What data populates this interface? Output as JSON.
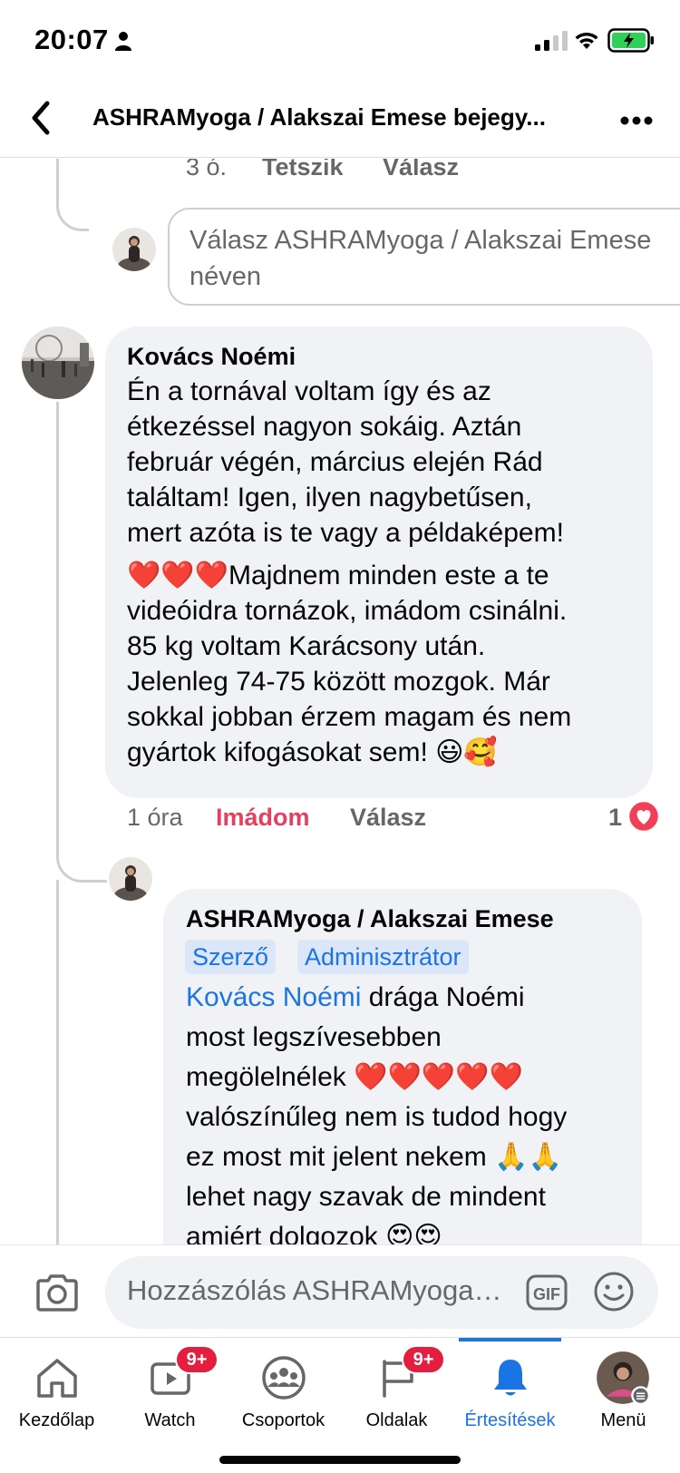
{
  "status_bar": {
    "time": "20:07",
    "icons": [
      "person-icon",
      "signal-icon",
      "wifi-icon",
      "battery-icon"
    ]
  },
  "header": {
    "title": "ASHRAMyoga   / Alakszai Emese bejegy...",
    "back_icon": "back-chevron-icon",
    "more_icon": "more-icon"
  },
  "previous_reply": {
    "time": "3 ó.",
    "like_label": "Tetszik",
    "reply_label": "Válasz"
  },
  "reply_box": {
    "placeholder": "Válasz ASHRAMyoga   / Alakszai Emese néven"
  },
  "comment": {
    "author": "Kovács Noémi",
    "lines": [
      "Én a tornával voltam így és az",
      "étkezéssel nagyon sokáig. Aztán",
      "február végén, március elején Rád",
      "találtam! Igen, ilyen nagybetűsen,",
      "mert azóta is te vagy a példaképem!"
    ],
    "lines2_first": "❤️❤️❤️Majdnem minden este a te",
    "lines2": [
      "videóidra tornázok, imádom csinálni.",
      "85 kg voltam Karácsony után.",
      "Jelenleg 74-75 között mozgok. Már",
      "sokkal jobban érzem magam és nem",
      "gyártok kifogásokat sem! 😃🥰"
    ],
    "time": "1 óra",
    "reaction_label": "Imádom",
    "reply_label": "Válasz",
    "reaction_count": "1",
    "reaction_icon": "heart-reaction-icon"
  },
  "reply": {
    "author": "ASHRAMyoga   / Alakszai Emese",
    "badges": [
      "Szerző",
      "Adminisztrátor"
    ],
    "mention": "Kovács Noémi",
    "first_line_rest": " drága Noémi",
    "lines": [
      "most legszívesebben",
      "megölelnélek ❤️❤️❤️❤️❤️",
      "valószínűleg nem is tudod hogy",
      "ez most mit jelent nekem 🙏🙏",
      "lehet nagy szavak de mindent",
      "amiért dolgozok 😍😍"
    ]
  },
  "composer": {
    "placeholder": "Hozzászólás ASHRAMyoga   / Alakszai Emese néven",
    "icons": [
      "camera-icon",
      "gif-icon",
      "smiley-icon"
    ]
  },
  "tabs": [
    {
      "label": "Kezdőlap",
      "icon": "home-icon",
      "badge": ""
    },
    {
      "label": "Watch",
      "icon": "watch-icon",
      "badge": "9+"
    },
    {
      "label": "Csoportok",
      "icon": "groups-icon",
      "badge": ""
    },
    {
      "label": "Oldalak",
      "icon": "pages-flag-icon",
      "badge": "9+"
    },
    {
      "label": "Értesítések",
      "icon": "bell-icon",
      "badge": "",
      "active": true
    },
    {
      "label": "Menü",
      "icon": "menu-avatar-icon",
      "badge": ""
    }
  ],
  "colors": {
    "accent": "#1b74e4",
    "love": "#e4405f",
    "bubble": "#f0f2f5",
    "badge_bg": "#dbe7f8",
    "notification": "#e41e3f"
  }
}
